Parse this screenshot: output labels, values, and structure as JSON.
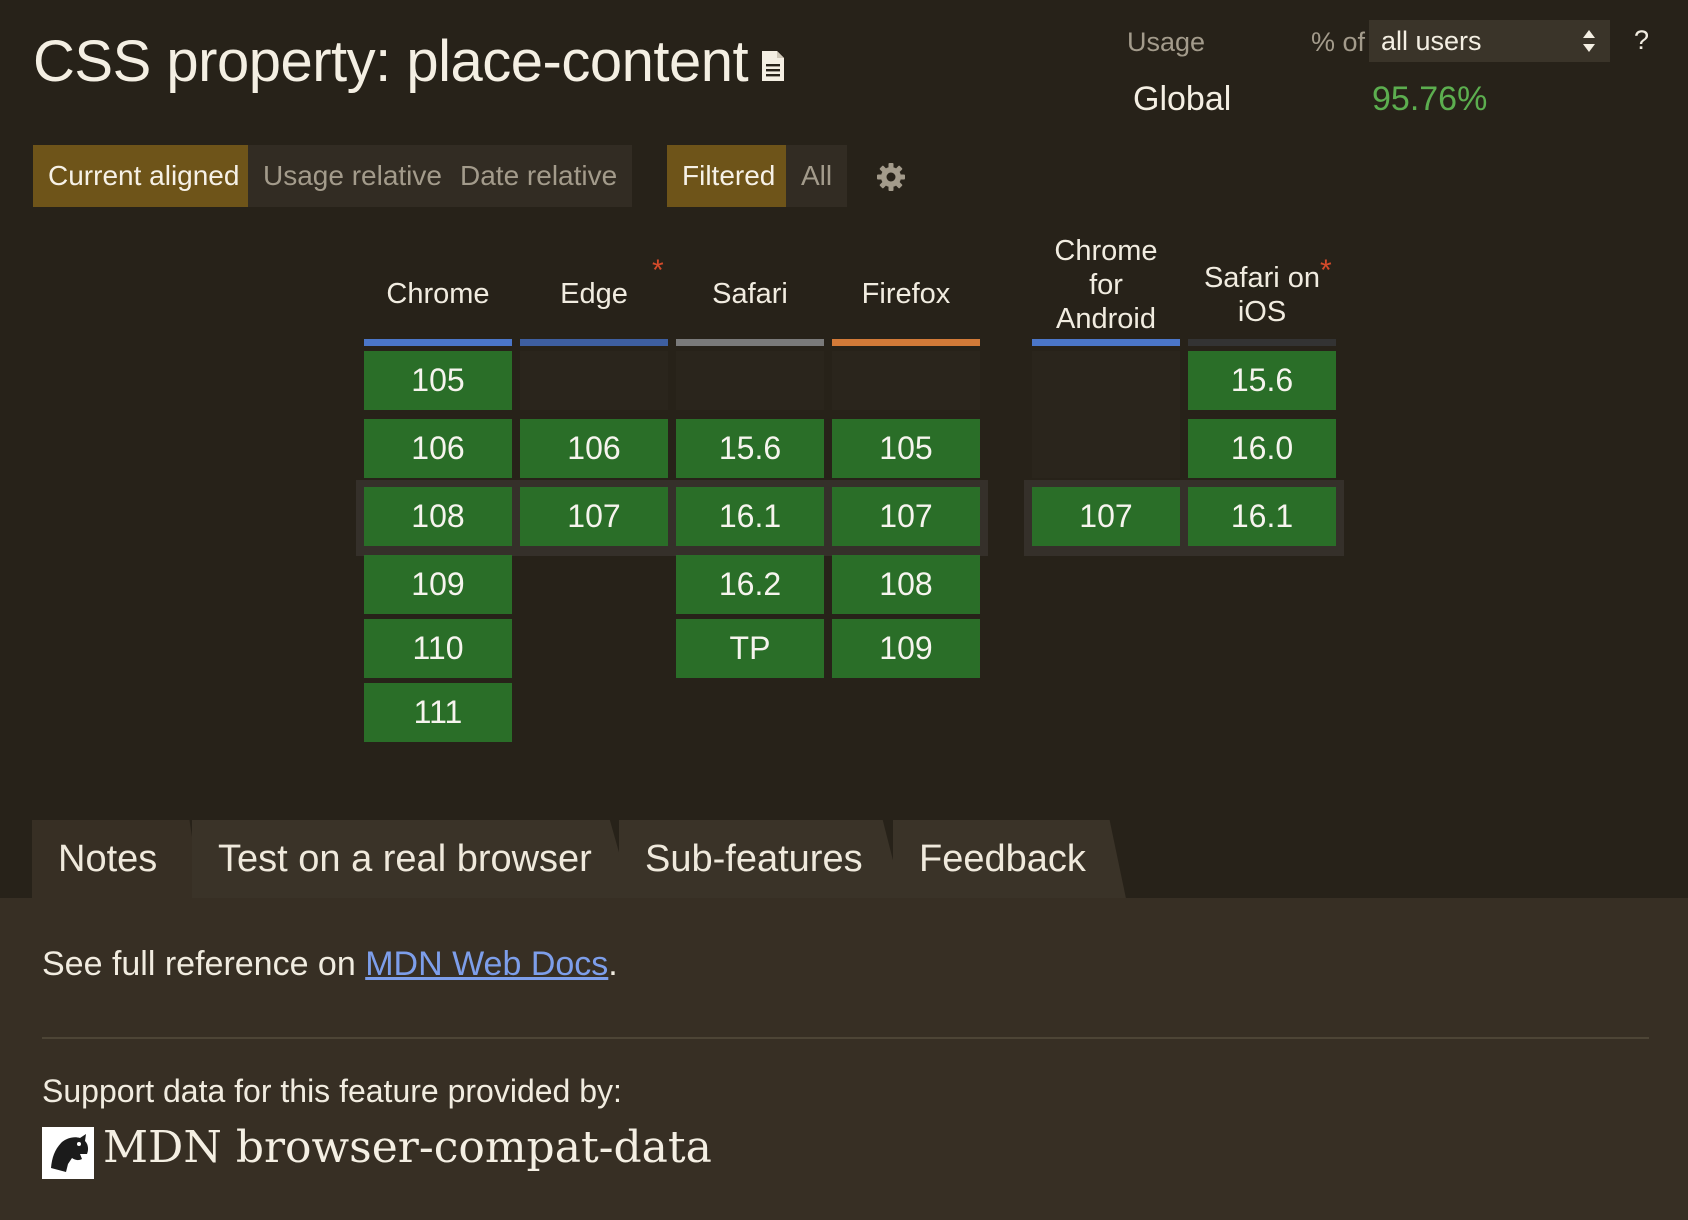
{
  "title": "CSS property: place-content",
  "usage": {
    "label": "Usage",
    "pct_of": "% of",
    "selected": "all users",
    "help": "?",
    "region": "Global",
    "percent": "95.76%"
  },
  "view_modes": [
    "Current aligned",
    "Usage relative",
    "Date relative"
  ],
  "filter_modes": [
    "Filtered",
    "All"
  ],
  "browsers": [
    {
      "name": "Chrome",
      "bar_color": "#4b76c8",
      "asterisk": "",
      "versions": [
        "105",
        "106",
        "108",
        "109",
        "110",
        "111"
      ]
    },
    {
      "name": "Edge",
      "bar_color": "#3e5fa0",
      "asterisk": "*",
      "versions": [
        "",
        "106",
        "107"
      ]
    },
    {
      "name": "Safari",
      "bar_color": "#7a7a7a",
      "asterisk": "",
      "versions": [
        "",
        "15.6",
        "16.1",
        "16.2",
        "TP"
      ]
    },
    {
      "name": "Firefox",
      "bar_color": "#d27a38",
      "asterisk": "",
      "versions": [
        "",
        "105",
        "107",
        "108",
        "109"
      ]
    },
    {
      "name_lines": [
        "Chrome",
        "for",
        "Android"
      ],
      "bar_color": "#4b76c8",
      "asterisk": "",
      "versions": [
        "",
        "",
        "107"
      ]
    },
    {
      "name_lines": [
        "Safari on",
        "iOS"
      ],
      "bar_color": "#333333",
      "asterisk": "*",
      "versions": [
        "15.6",
        "16.0",
        "16.1"
      ]
    }
  ],
  "tabs": [
    "Notes",
    "Test on a real browser",
    "Sub-features",
    "Feedback"
  ],
  "notes": {
    "ref_prefix": "See full reference on ",
    "ref_link": "MDN Web Docs",
    "ref_suffix": ".",
    "support_text": "Support data for this feature provided by:",
    "mdn_text": "MDN browser-compat-data"
  },
  "icons": [
    "document-icon",
    "select-arrows-icon",
    "gear-icon",
    "mdn-dino-icon"
  ]
}
